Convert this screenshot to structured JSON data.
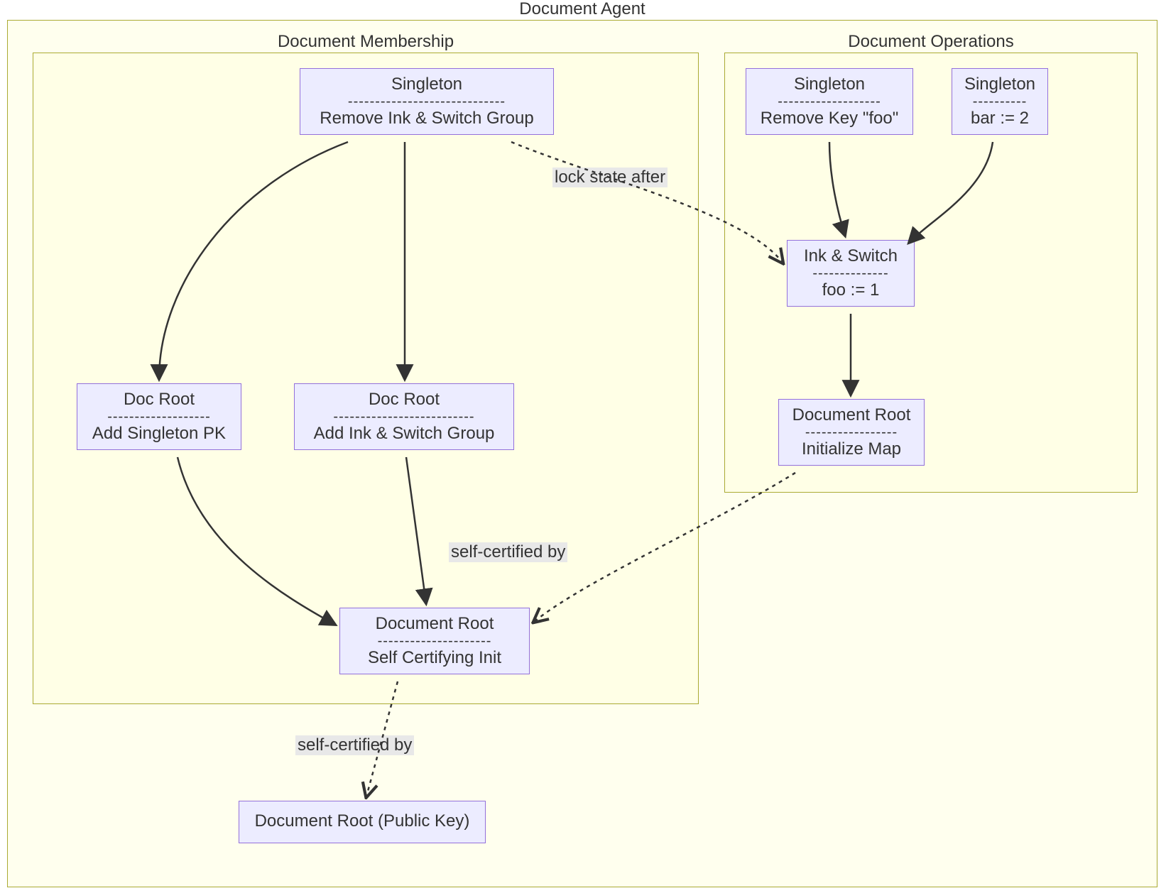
{
  "clusters": {
    "outer": {
      "title": "Document Agent"
    },
    "left": {
      "title": "Document Membership"
    },
    "right": {
      "title": "Document Operations"
    }
  },
  "nodes": {
    "n1": {
      "title": "Singleton",
      "op": "Remove Ink & Switch Group"
    },
    "n2": {
      "title": "Singleton",
      "op": "Remove Key \"foo\""
    },
    "n3": {
      "title": "Singleton",
      "op": "bar := 2"
    },
    "n4": {
      "title": "Ink & Switch",
      "op": "foo := 1"
    },
    "n5": {
      "title": "Document Root",
      "op": "Initialize Map"
    },
    "n6": {
      "title": "Doc Root",
      "op": "Add Singleton PK"
    },
    "n7": {
      "title": "Doc Root",
      "op": "Add Ink & Switch Group"
    },
    "n8": {
      "title": "Document Root",
      "op": "Self Certifying Init"
    },
    "n9": {
      "title": "Document Root (Public Key)"
    }
  },
  "edgeLabels": {
    "lock_state": "lock state after",
    "self_cert_1": "self-certified by",
    "self_cert_2": "self-certified by"
  },
  "colors": {
    "cluster_fill": "#ffffde",
    "cluster_border": "#aaaa33",
    "node_fill": "#ececff",
    "node_border": "#9370db",
    "label_bg": "#e8e8e8",
    "text": "#333333",
    "edge": "#333333"
  }
}
